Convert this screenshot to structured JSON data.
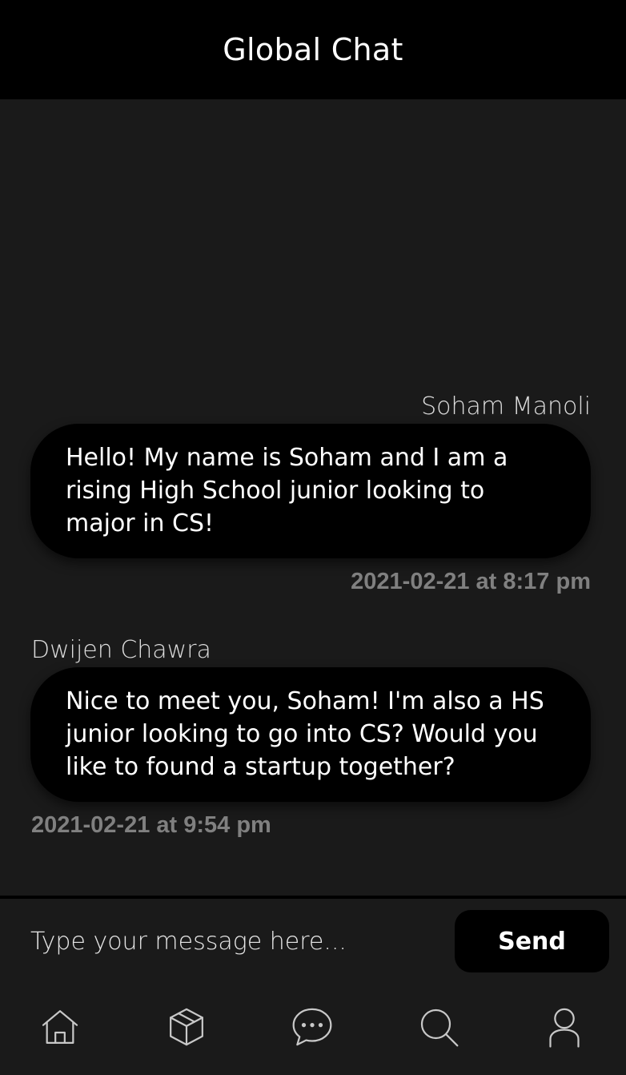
{
  "header": {
    "title": "Global Chat"
  },
  "messages": [
    {
      "sender": "Soham Manoli",
      "text": "Hello! My name is Soham and I am a rising High School junior looking to major in CS!",
      "timestamp": "2021-02-21 at 8:17 pm",
      "alignment": "right"
    },
    {
      "sender": "Dwijen Chawra",
      "text": "Nice to meet you, Soham! I'm also a HS junior looking to go into CS? Would you like to found a startup together?",
      "timestamp": "2021-02-21 at 9:54 pm",
      "alignment": "left"
    }
  ],
  "composer": {
    "placeholder": "Type your message here...",
    "value": "",
    "send_label": "Send"
  },
  "nav": {
    "items": [
      {
        "name": "home",
        "icon": "home-icon"
      },
      {
        "name": "explore",
        "icon": "cube-icon"
      },
      {
        "name": "chat",
        "icon": "chat-bubble-icon"
      },
      {
        "name": "search",
        "icon": "search-icon"
      },
      {
        "name": "profile",
        "icon": "user-icon"
      }
    ]
  },
  "colors": {
    "background": "#1a1a1a",
    "header": "#000000",
    "bubble": "#000000",
    "text": "#ffffff",
    "timestamp": "#808080",
    "icon": "#c8c8c8"
  }
}
